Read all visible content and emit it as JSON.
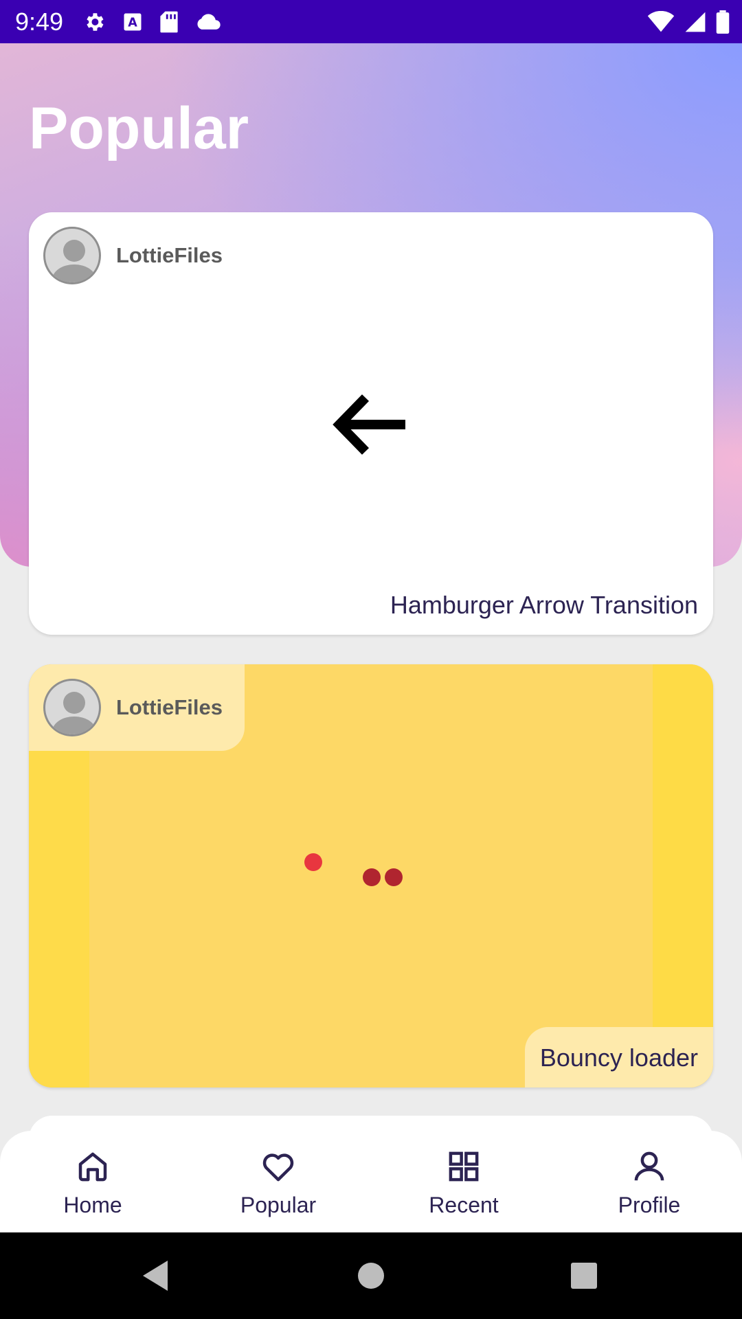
{
  "status_bar": {
    "time": "9:49",
    "left_icons": [
      "gear-icon",
      "text-a-icon",
      "sd-card-icon",
      "cloud-icon"
    ],
    "right_icons": [
      "wifi-icon",
      "signal-icon",
      "battery-icon"
    ],
    "background": "#3a00b2"
  },
  "header": {
    "title": "Popular"
  },
  "cards": [
    {
      "author": "LottieFiles",
      "title": "Hamburger Arrow Transition",
      "animation_icon": "arrow-left-icon",
      "background": "#ffffff"
    },
    {
      "author": "LottieFiles",
      "title": "Bouncy loader",
      "animation_icon": "bouncing-dots",
      "background": "#fdd865"
    }
  ],
  "bottom_nav": {
    "items": [
      {
        "label": "Home",
        "icon": "home-icon"
      },
      {
        "label": "Popular",
        "icon": "heart-icon"
      },
      {
        "label": "Recent",
        "icon": "grid-icon"
      },
      {
        "label": "Profile",
        "icon": "person-icon"
      }
    ]
  },
  "system_nav": {
    "buttons": [
      "back-icon",
      "home-circle-icon",
      "recents-square-icon"
    ]
  },
  "colors": {
    "accent_dark": "#2c2352",
    "dot_red": "#e8363f",
    "dot_dark_red": "#b0252f"
  }
}
